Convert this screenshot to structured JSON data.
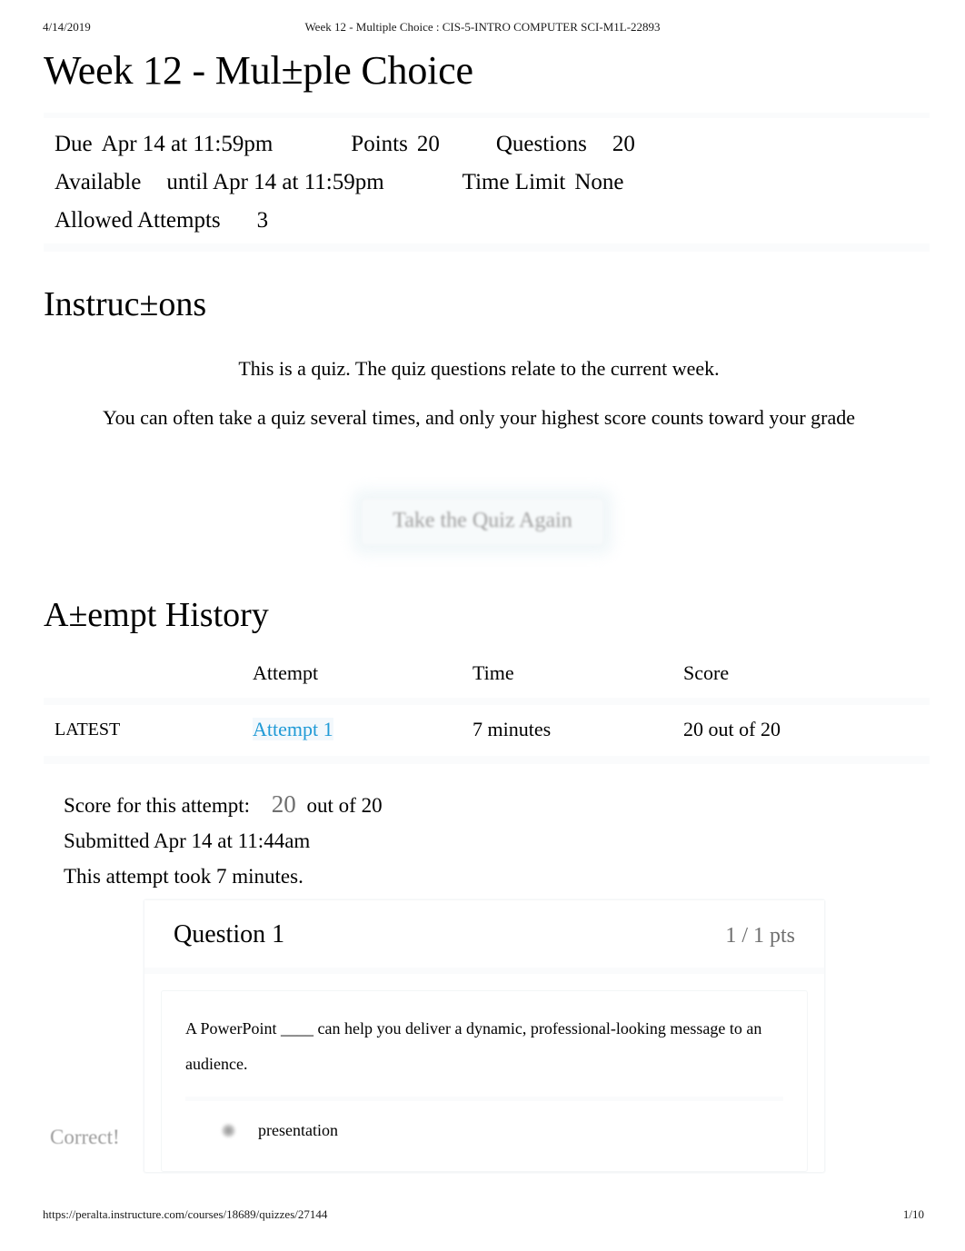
{
  "print": {
    "date": "4/14/2019",
    "doc_title": "Week 12 - Multiple Choice : CIS-5-INTRO COMPUTER SCI-M1L-22893",
    "url": "https://peralta.instructure.com/courses/18689/quizzes/27144",
    "page_number": "1/10"
  },
  "quiz": {
    "title": "Week 12 - Mul±ple Choice",
    "meta": {
      "due_label": "Due",
      "due_value": "Apr 14 at 11:59pm",
      "points_label": "Points",
      "points_value": "20",
      "questions_label": "Questions",
      "questions_value": "20",
      "available_label": "Available",
      "available_value": "until Apr 14 at 11:59pm",
      "time_limit_label": "Time Limit",
      "time_limit_value": "None",
      "allowed_attempts_label": "Allowed Attempts",
      "allowed_attempts_value": "3"
    }
  },
  "instructions": {
    "heading": "Instruc±ons",
    "paragraphs": [
      "This is a quiz. The quiz questions relate to the current week.",
      "You can often take a quiz several times, and only your highest score counts toward your grade"
    ],
    "take_again_button": "Take the Quiz Again"
  },
  "attempt_history": {
    "heading": "A±empt History",
    "columns": {
      "kept": "",
      "attempt": "Attempt",
      "time": "Time",
      "score": "Score"
    },
    "rows": [
      {
        "kept": "LATEST",
        "attempt": "Attempt 1",
        "time": "7 minutes",
        "score": "20 out of 20"
      }
    ]
  },
  "attempt_summary": {
    "score_label": "Score for this attempt:",
    "score_value": "20",
    "score_out_of": "out of 20",
    "submitted": "Submitted Apr 14 at 11:44am",
    "duration": "This attempt took 7 minutes."
  },
  "questions": [
    {
      "name": "Question 1",
      "points": "1 / 1 pts",
      "text": "A PowerPoint ____ can help you deliver a dynamic, professional-looking message to an audience.",
      "result_flag": "Correct!",
      "answers": [
        {
          "label": "presentation",
          "selected": true
        }
      ]
    }
  ],
  "colors": {
    "link_blue": "#1f9ad6",
    "muted_gray": "#6f6f6f",
    "panel_tint": "#fafbfc",
    "text": "#000000"
  }
}
